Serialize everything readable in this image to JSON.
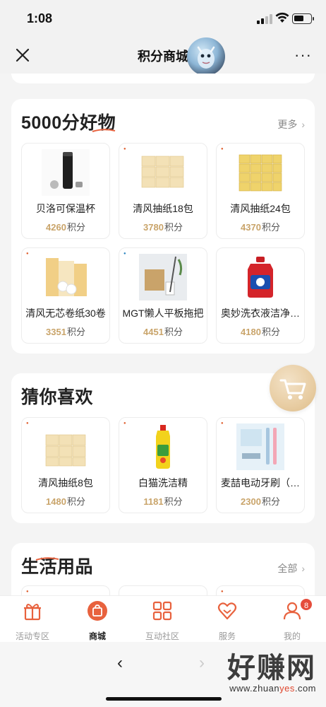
{
  "status": {
    "time": "1:08"
  },
  "nav": {
    "title": "积分商城",
    "close_icon": "close-icon",
    "more_label": "···"
  },
  "sections": [
    {
      "title": "5000分好物",
      "more": "更多",
      "items": [
        {
          "name": "贝洛可保温杯",
          "points": "4260",
          "unit": "积分"
        },
        {
          "name": "清风抽纸18包",
          "points": "3780",
          "unit": "积分"
        },
        {
          "name": "清风抽纸24包",
          "points": "4370",
          "unit": "积分"
        },
        {
          "name": "清风无芯卷纸30卷",
          "points": "3351",
          "unit": "积分"
        },
        {
          "name": "MGT懒人平板拖把",
          "points": "4451",
          "unit": "积分"
        },
        {
          "name": "奥妙洗衣液洁净…",
          "points": "4180",
          "unit": "积分"
        }
      ]
    },
    {
      "title": "猜你喜欢",
      "more": "",
      "items": [
        {
          "name": "清风抽纸8包",
          "points": "1480",
          "unit": "积分"
        },
        {
          "name": "白猫洗洁精",
          "points": "1181",
          "unit": "积分"
        },
        {
          "name": "麦喆电动牙刷（…",
          "points": "2300",
          "unit": "积分"
        }
      ]
    },
    {
      "title": "生活用品",
      "more": "全部",
      "items": []
    }
  ],
  "tabs": [
    {
      "label": "活动专区",
      "icon": "gift-icon"
    },
    {
      "label": "商城",
      "icon": "shopping-bag-icon"
    },
    {
      "label": "互动社区",
      "icon": "grid-icon"
    },
    {
      "label": "服务",
      "icon": "heart-icon"
    },
    {
      "label": "我的",
      "icon": "user-icon",
      "badge": "8"
    }
  ],
  "colors": {
    "accent": "#e8623e",
    "points": "#c9a46a",
    "badge": "#e54d3c"
  },
  "watermark": {
    "big": "好赚网",
    "small_prefix": "www.zhuan",
    "small_highlight": "yes",
    "small_suffix": ".com"
  }
}
